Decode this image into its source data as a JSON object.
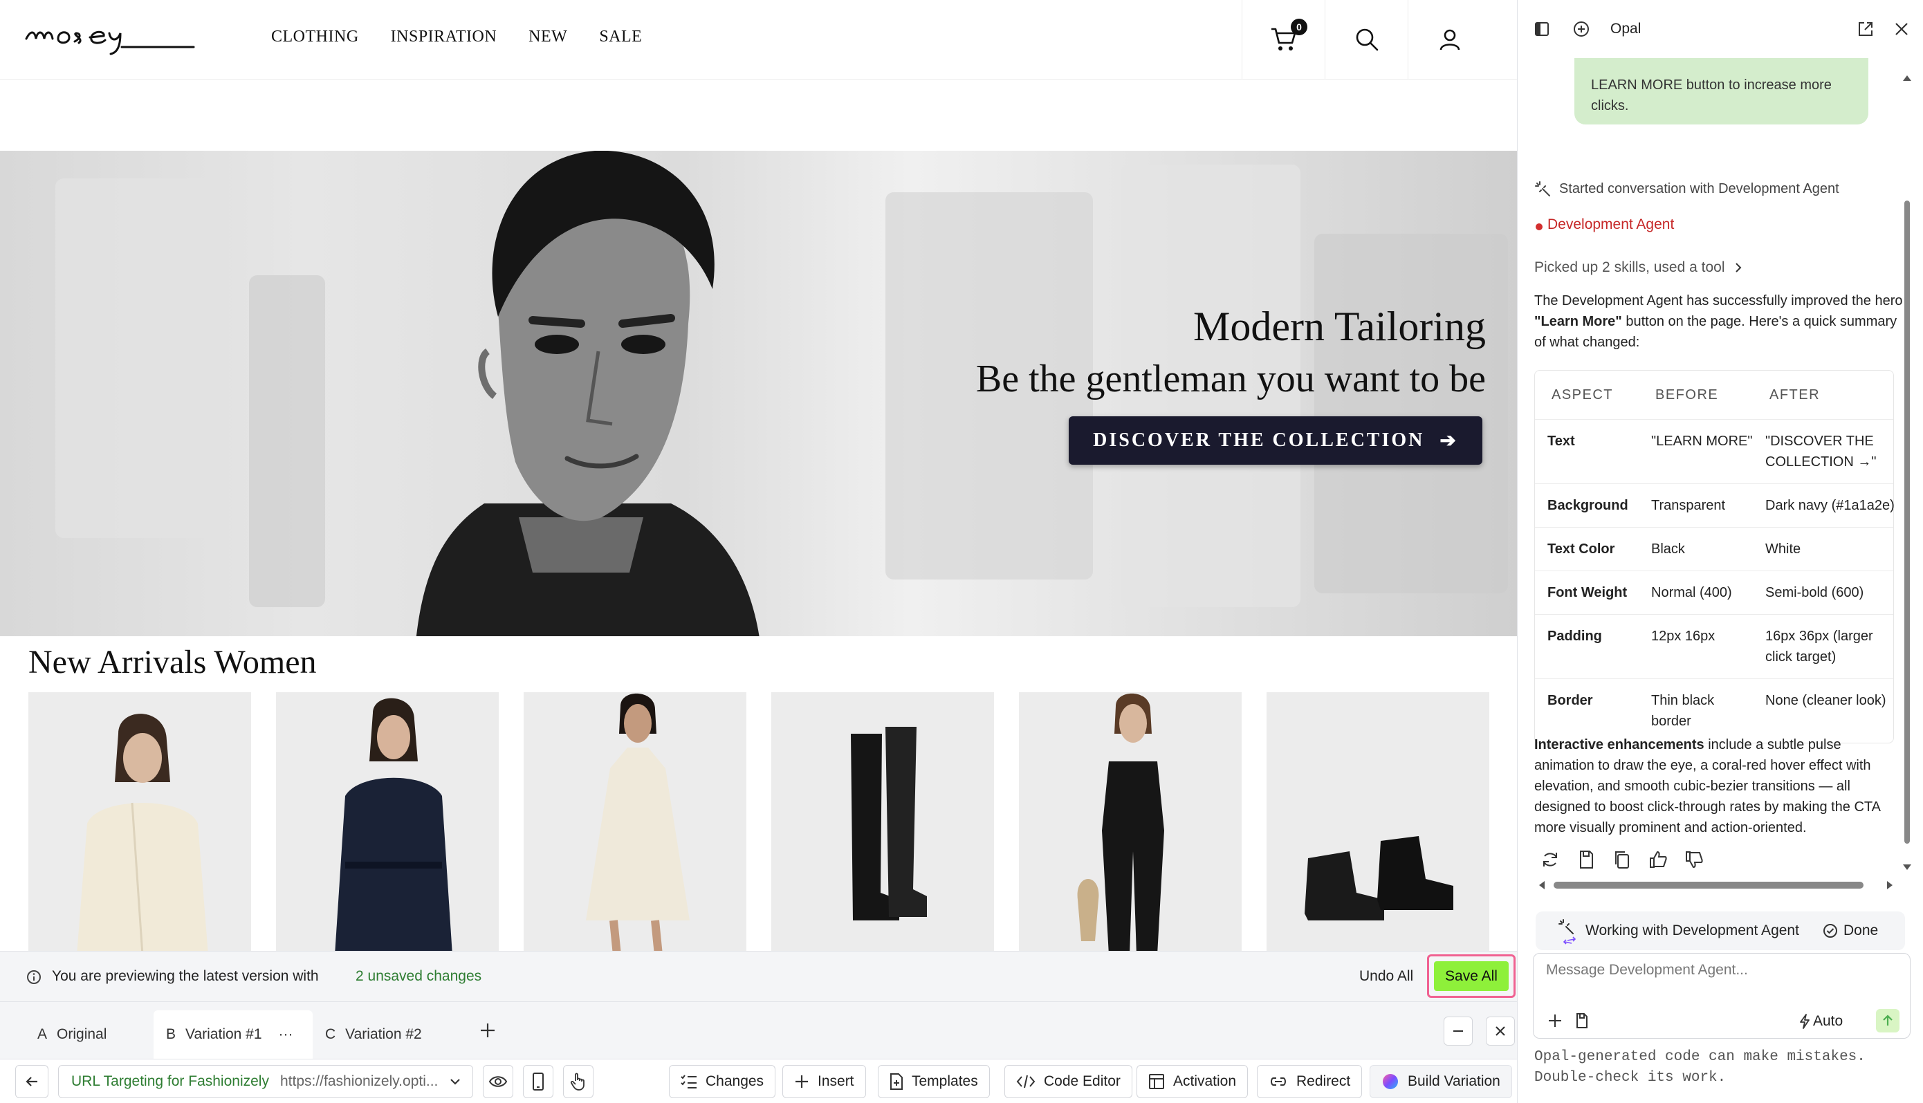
{
  "site": {
    "logo_text": "mosey",
    "nav": [
      "CLOTHING",
      "INSPIRATION",
      "NEW",
      "SALE"
    ],
    "cart_count": "0",
    "hero": {
      "title": "Modern Tailoring",
      "subtitle": "Be the gentleman you want to be",
      "cta_label": "DISCOVER THE COLLECTION",
      "cta_arrow": "➔",
      "cta_bg": "#1a1a2e"
    },
    "arrivals_title": "New Arrivals Women",
    "products": [
      {
        "icon": "cream-blouse"
      },
      {
        "icon": "navy-coat"
      },
      {
        "icon": "white-halter-dress"
      },
      {
        "icon": "black-knee-boots"
      },
      {
        "icon": "black-jumpsuit"
      },
      {
        "icon": "black-ankle-boots"
      }
    ]
  },
  "preview_bar": {
    "text": "You are previewing the latest version with",
    "unsaved_link": "2 unsaved changes",
    "undo_all": "Undo All",
    "save_all": "Save All",
    "save_color": "#8ef03a"
  },
  "tabs": [
    {
      "letter": "A",
      "label": "Original"
    },
    {
      "letter": "B",
      "label": "Variation #1",
      "more": "···"
    },
    {
      "letter": "C",
      "label": "Variation #2"
    }
  ],
  "toolbar": {
    "url_label": "URL Targeting for Fashionizely",
    "url_value": "https://fashionizely.opti...",
    "buttons": [
      "Changes",
      "Insert",
      "Templates",
      "Code Editor",
      "Activation",
      "Redirect",
      "Build Variation"
    ]
  },
  "opal": {
    "title": "Opal",
    "user_bubble_text": "LEARN MORE button to increase more clicks.",
    "started_text": "Started conversation with Development Agent",
    "agent_name": "Development Agent",
    "skills_text": "Picked up 2 skills, used a tool",
    "summary_pre": "The Development Agent has successfully improved the hero ",
    "summary_bold": "\"Learn More\"",
    "summary_post": " button on the page. Here's a quick summary of what changed:",
    "table_headers": [
      "ASPECT",
      "BEFORE",
      "AFTER"
    ],
    "table_rows": [
      [
        "Text",
        "\"LEARN MORE\"",
        "\"DISCOVER THE COLLECTION →\""
      ],
      [
        "Background",
        "Transparent",
        "Dark navy (#1a1a2e)"
      ],
      [
        "Text Color",
        "Black",
        "White"
      ],
      [
        "Font Weight",
        "Normal (400)",
        "Semi-bold (600)"
      ],
      [
        "Padding",
        "12px 16px",
        "16px 36px (larger click target)"
      ],
      [
        "Border",
        "Thin black border",
        "None (cleaner look)"
      ]
    ],
    "enh_bold": "Interactive enhancements",
    "enh_text": " include a subtle pulse animation to draw the eye, a coral-red hover effect with elevation, and smooth cubic-bezier transitions — all designed to boost click-through rates by making the CTA more visually prominent and action-oriented.",
    "working_text": "Working with Development Agent",
    "done_text": "Done",
    "message_placeholder": "Message Development Agent...",
    "auto_label": "Auto",
    "disclaimer_line1": "Opal-generated code can make mistakes.",
    "disclaimer_line2": "Double-check its work."
  }
}
